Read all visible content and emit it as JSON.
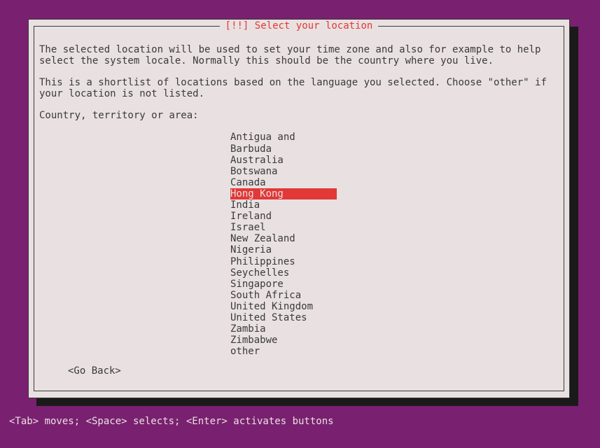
{
  "title": "[!!] Select your location",
  "help_text_1": "The selected location will be used to set your time zone and also for example to help select the system locale. Normally this should be the country where you live.",
  "help_text_2": "This is a shortlist of locations based on the language you selected. Choose \"other\" if your location is not listed.",
  "prompt": "Country, territory or area:",
  "locations": [
    "Antigua and Barbuda",
    "Australia",
    "Botswana",
    "Canada",
    "Hong Kong",
    "India",
    "Ireland",
    "Israel",
    "New Zealand",
    "Nigeria",
    "Philippines",
    "Seychelles",
    "Singapore",
    "South Africa",
    "United Kingdom",
    "United States",
    "Zambia",
    "Zimbabwe",
    "other"
  ],
  "selected_index": 4,
  "go_back": "<Go Back>",
  "footer": "<Tab> moves; <Space> selects; <Enter> activates buttons"
}
